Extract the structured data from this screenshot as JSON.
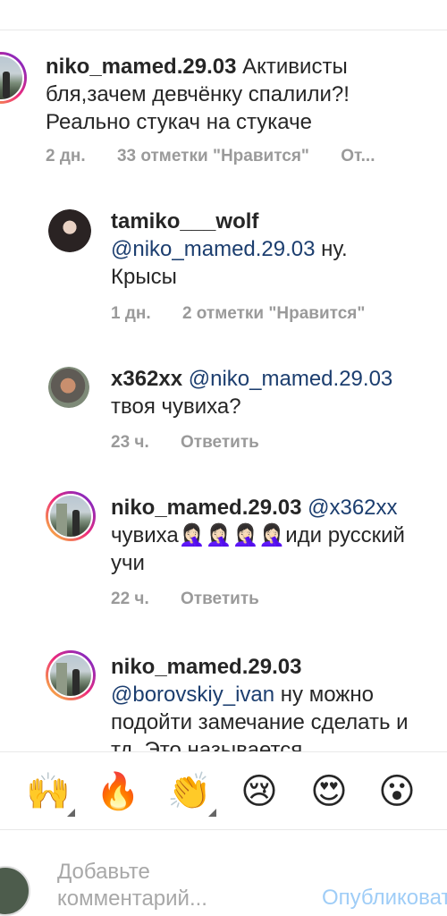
{
  "comments": [
    {
      "username": "niko_mamed.29.03",
      "mention": "",
      "text": "Активисты бля,зачем девчёнку спалили?! Реально стукач на стукаче",
      "time": "2 дн.",
      "likes": "33 отметки \"Нравится\"",
      "reply": "От..."
    },
    {
      "username": "tamiko___wolf",
      "mention": "@niko_mamed.29.03",
      "text": " ну. Крысы",
      "time": "1 дн.",
      "likes": "2 отметки \"Нравится\"",
      "reply": ""
    },
    {
      "username": "x362xx",
      "mention": "@niko_mamed.29.03",
      "text": " твоя чувиха?",
      "time": "23 ч.",
      "likes": "",
      "reply": "Ответить"
    },
    {
      "username": "niko_mamed.29.03",
      "mention": "@x362xx",
      "text": " чувиха🤦🏻‍♀️🤦🏻‍♀️🤦🏻‍♀️🤦🏻‍♀️иди русский учи",
      "time": "22 ч.",
      "likes": "",
      "reply": "Ответить"
    },
    {
      "username": "niko_mamed.29.03",
      "mention": "@borovskiy_ivan",
      "text": " ну можно подойти замечание сделать и тд. Это называется",
      "time": "",
      "likes": "",
      "reply": ""
    }
  ],
  "emojis": [
    "🙌",
    "🔥",
    "👏",
    "😢",
    "😍",
    "😮"
  ],
  "input": {
    "placeholder": "Добавьте комментарий...",
    "post_label": "Опубликовать"
  }
}
